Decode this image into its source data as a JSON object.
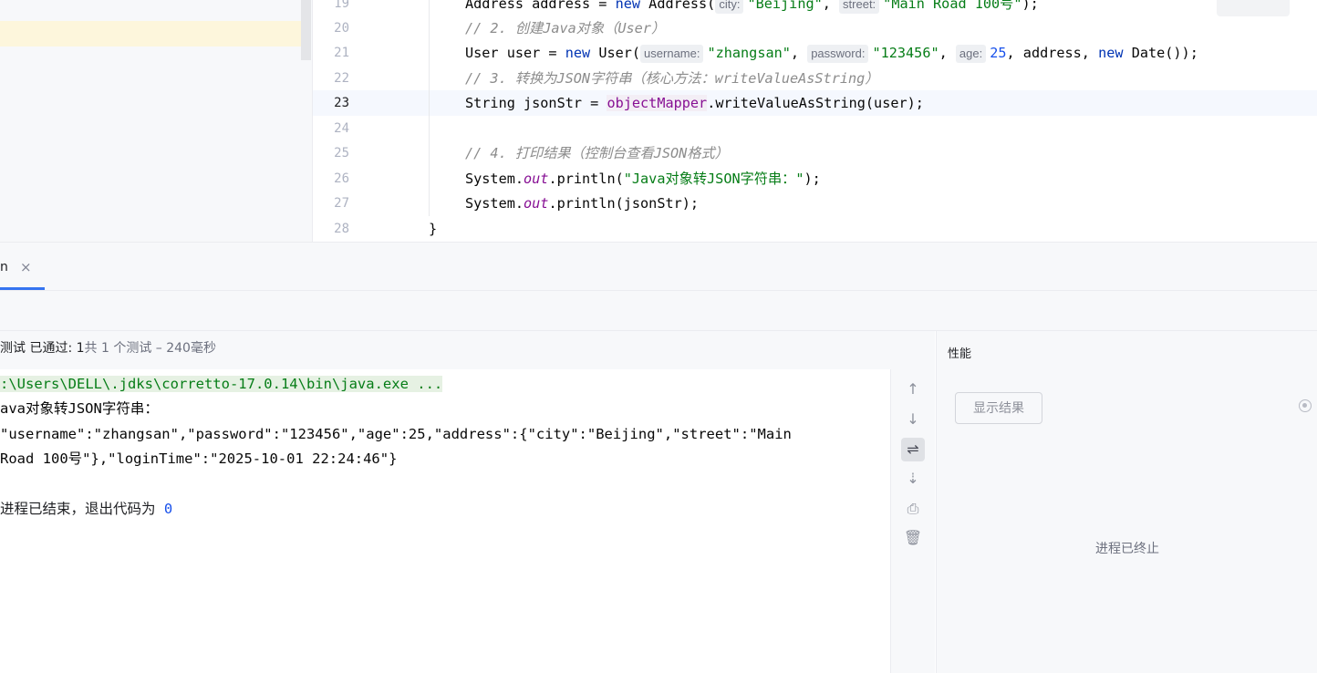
{
  "editor": {
    "lines": [
      {
        "n": "19"
      },
      {
        "n": "20"
      },
      {
        "n": "21"
      },
      {
        "n": "22"
      },
      {
        "n": "23"
      },
      {
        "n": "24"
      },
      {
        "n": "25"
      },
      {
        "n": "26"
      },
      {
        "n": "27"
      },
      {
        "n": "28"
      }
    ],
    "l19": {
      "a": "Address address = ",
      "kw": "new",
      "b": " Address(",
      "h1": "city:",
      "s1": "\"Beijing\"",
      "c": ", ",
      "h2": "street:",
      "s2": "\"Main Road 100号\"",
      "d": ");"
    },
    "l20": "// 2. 创建Java对象（User）",
    "l21": {
      "a": "User user = ",
      "kw": "new",
      "b": " User(",
      "h1": "username:",
      "s1": "\"zhangsan\"",
      "c": ", ",
      "h2": "password:",
      "s2": "\"123456\"",
      "d": ", ",
      "h3": "age:",
      "n1": "25",
      "e": ", address, ",
      "kw2": "new",
      "f": " Date());"
    },
    "l22": "// 3. 转换为JSON字符串（核心方法：writeValueAsString）",
    "l23": {
      "a": "String jsonStr = ",
      "fld": "objectMapper",
      "b": ".writeValueAsString(user);"
    },
    "l25": "// 4. 打印结果（控制台查看JSON格式）",
    "l26": {
      "a": "System.",
      "st": "out",
      "b": ".println(",
      "s": "\"Java对象转JSON字符串：\"",
      "c": ");"
    },
    "l27": {
      "a": "System.",
      "st": "out",
      "b": ".println(jsonStr);"
    },
    "l28": "}"
  },
  "tool_window": {
    "tab_label": "n",
    "tab_close": "×"
  },
  "status": {
    "prefix": "测试 已通过: 1",
    "detail": "共 1 个测试 – 240毫秒"
  },
  "console": {
    "lines": [
      ":\\Users\\DELL\\.jdks\\corretto-17.0.14\\bin\\java.exe ...",
      "ava对象转JSON字符串：",
      "\"username\":\"zhangsan\",\"password\":\"123456\",\"age\":25,\"address\":{\"city\":\"Beijing\",\"street\":\"Main",
      "Road 100号\"},\"loginTime\":\"2025-10-01 22:24:46\"}",
      "",
      "进程已结束，退出代码为 "
    ],
    "exit_code": "0"
  },
  "side_tools": [
    {
      "icon": "arrow-up-icon",
      "glyph": "↑"
    },
    {
      "icon": "arrow-down-icon",
      "glyph": "↓"
    },
    {
      "icon": "soft-wrap-icon",
      "glyph": "⇌"
    },
    {
      "icon": "scroll-to-end-icon",
      "glyph": "⇣"
    },
    {
      "icon": "print-icon",
      "glyph": "⎙"
    },
    {
      "icon": "trash-icon",
      "glyph": "🗑"
    }
  ],
  "performance": {
    "title": "性能",
    "show_results": "显示结果",
    "terminated": "进程已终止"
  },
  "colors": {
    "accent": "#3574f0",
    "string": "#067d17",
    "keyword": "#0033b3"
  }
}
